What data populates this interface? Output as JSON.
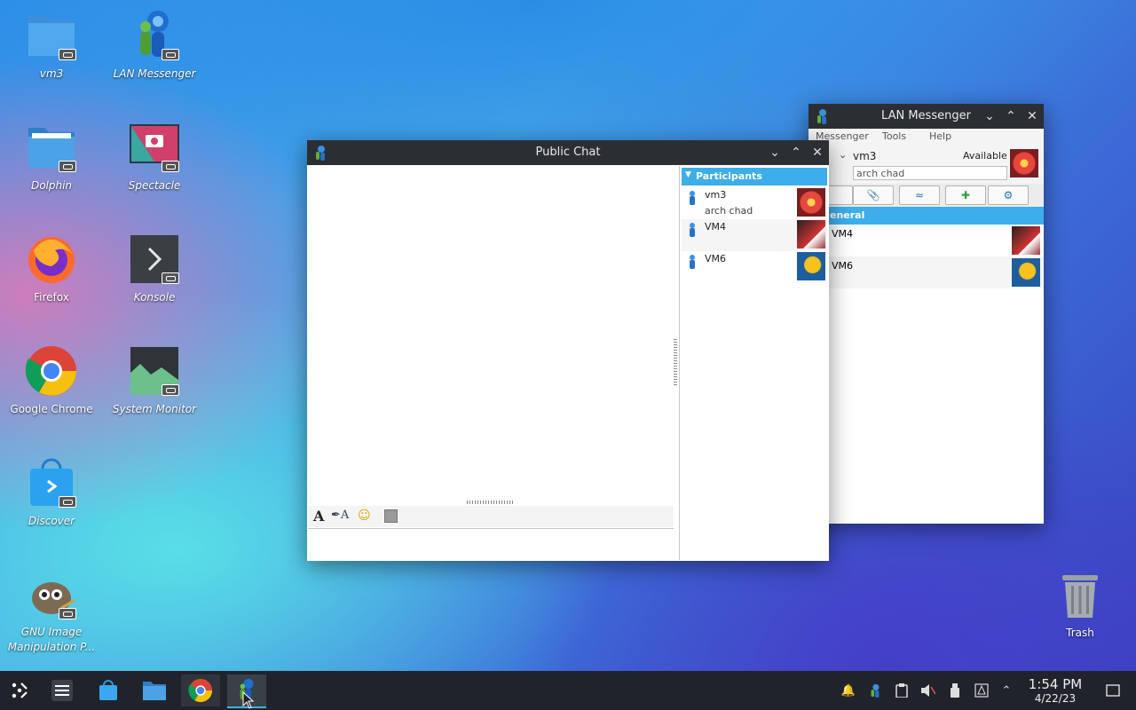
{
  "desktop": {
    "icons": [
      {
        "label": "vm3"
      },
      {
        "label": "LAN Messenger"
      },
      {
        "label": "Dolphin"
      },
      {
        "label": "Spectacle"
      },
      {
        "label": "Firefox"
      },
      {
        "label": "Konsole"
      },
      {
        "label": "Google Chrome"
      },
      {
        "label": "System Monitor"
      },
      {
        "label": "Discover"
      },
      {
        "label": "GNU Image Manipulation P..."
      },
      {
        "label": "Trash"
      }
    ]
  },
  "public_chat": {
    "title": "Public Chat",
    "participants_header": "Participants",
    "participants": [
      {
        "name": "vm3",
        "note": "arch chad"
      },
      {
        "name": "VM4",
        "note": ""
      },
      {
        "name": "VM6",
        "note": ""
      }
    ]
  },
  "lan_messenger": {
    "title": "LAN Messenger",
    "menu": [
      "Messenger",
      "Tools",
      "Help"
    ],
    "user_name": "vm3",
    "status": "Available",
    "note_value": "arch chad",
    "group_header": "eneral",
    "contacts": [
      {
        "name": "VM4"
      },
      {
        "name": "VM6"
      }
    ]
  },
  "taskbar": {
    "time": "1:54 PM",
    "date": "4/22/23"
  },
  "colors": {
    "accent": "#3daee9",
    "titlebar": "#2b2f33",
    "taskbar": "#20242a"
  }
}
